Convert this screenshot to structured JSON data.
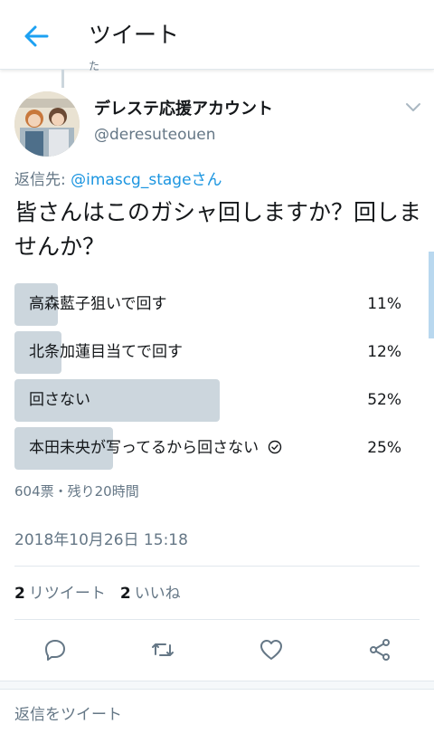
{
  "header": {
    "title": "ツイート"
  },
  "thread": {
    "snippet": "た"
  },
  "author": {
    "name": "デレステ応援アカウント",
    "handle": "@deresuteouen"
  },
  "reply": {
    "prefix": "返信先: ",
    "mention": "@imascg_stageさん"
  },
  "tweet": {
    "text": "皆さんはこのガシャ回しますか？回しませんか？"
  },
  "poll": {
    "options": [
      {
        "label": "高森藍子狙いで回す",
        "percent": "11%",
        "fraction": 0.11
      },
      {
        "label": "北条加蓮目当てで回す",
        "percent": "12%",
        "fraction": 0.12
      },
      {
        "label": "回さない",
        "percent": "52%",
        "fraction": 0.52
      },
      {
        "label": "本田未央が写ってるから回さない",
        "percent": "25%",
        "fraction": 0.25,
        "voted": true
      }
    ],
    "meta": "604票・残り20時間"
  },
  "timestamp": "2018年10月26日 15:18",
  "stats": {
    "retweets_count": "2",
    "retweets_label": "リツイート",
    "likes_count": "2",
    "likes_label": "いいね"
  },
  "actions": [
    "reply-icon",
    "retweet-icon",
    "like-icon",
    "share-icon"
  ],
  "reply_box": {
    "placeholder": "返信をツイート"
  },
  "colors": {
    "accent": "#1da1f2",
    "link": "#1b95e0",
    "bar": "#ccd6dd",
    "muted": "#657786"
  }
}
